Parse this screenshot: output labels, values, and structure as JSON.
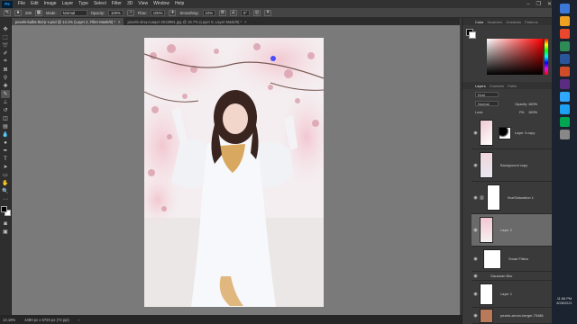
{
  "menubar": {
    "app_logo": "Ps",
    "items": [
      "File",
      "Edit",
      "Image",
      "Layer",
      "Type",
      "Select",
      "Filter",
      "3D",
      "View",
      "Window",
      "Help"
    ],
    "window_controls": [
      "–",
      "❐",
      "✕"
    ]
  },
  "options": {
    "mode_label": "Mode:",
    "mode_value": "Normal",
    "opacity_label": "Opacity:",
    "opacity_value": "100%",
    "flow_label": "Flow:",
    "flow_value": "100%",
    "smoothing_label": "Smoothing:",
    "smoothing_value": "10%",
    "angle_value": "0°",
    "brush_size": "200"
  },
  "tabs": [
    {
      "label": "pexels-bulbs-tbd-jr-v.psd @ 13.1% (Layer 2, Filter Mask/8) *",
      "close": "×"
    },
    {
      "label": "pexels-ulnq-cuaqer-2019991.jpg @ 16.7% (Layer 0, Layer Mask/8) *",
      "close": "×"
    }
  ],
  "status": {
    "zoom": "13.19%",
    "doc_info": "4480 px x 6720 px (72 ppi)",
    "arrow": "›"
  },
  "color_panel": {
    "tabs": [
      "Color",
      "Swatches",
      "Gradients",
      "Patterns"
    ],
    "active": "Color"
  },
  "layers_panel": {
    "tabs": [
      "Layers",
      "Channels",
      "Paths"
    ],
    "active": "Layers",
    "kind_label": "Kind",
    "blend_mode": "Normal",
    "opacity_label": "Opacity:",
    "opacity_value": "100%",
    "lock_label": "Lock:",
    "fill_label": "Fill:",
    "fill_value": "100%",
    "layers": [
      {
        "name": "Layer 3 copy",
        "visible": true,
        "selected": false,
        "has_mask": true
      },
      {
        "name": "Background copy",
        "visible": true,
        "selected": false,
        "has_mask": false
      },
      {
        "name": "Hue/Saturation 1",
        "visible": true,
        "selected": false,
        "has_mask": false
      },
      {
        "name": "Layer 2",
        "visible": true,
        "selected": true,
        "has_mask": false
      },
      {
        "name": "Smart Filters",
        "visible": true,
        "selected": false,
        "has_mask": false
      },
      {
        "name": "Gaussian Blur",
        "visible": true,
        "selected": false,
        "has_mask": false
      },
      {
        "name": "Layer 1",
        "visible": true,
        "selected": false,
        "has_mask": false
      },
      {
        "name": "pexels-simon-berger-79486",
        "visible": true,
        "selected": false,
        "has_mask": false
      }
    ]
  },
  "taskbar": {
    "time": "11:56 PM",
    "date": "8/28/2021"
  },
  "colors": {
    "accent": "#31a8ff",
    "panel": "#3a3a3a",
    "canvas": "#7a7a7a"
  }
}
